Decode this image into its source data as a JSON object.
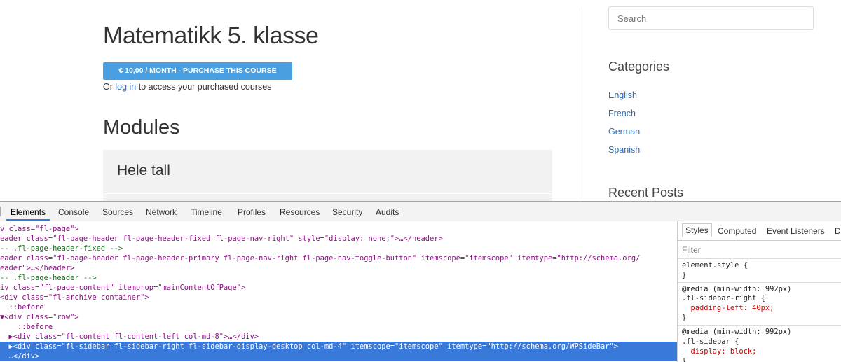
{
  "page": {
    "title": "Matematikk 5. klasse",
    "purchase_button": "€ 10,00 / MONTH - PURCHASE THIS COURSE",
    "login_prefix": "Or ",
    "login_link": "log in",
    "login_suffix": " to access your purchased courses",
    "modules_heading": "Modules",
    "module_name": "Hele tall"
  },
  "sidebar": {
    "search_placeholder": "Search",
    "categories_title": "Categories",
    "categories": [
      "English",
      "French",
      "German",
      "Spanish"
    ],
    "recent_posts_title": "Recent Posts"
  },
  "devtools": {
    "tabs": [
      "Elements",
      "Console",
      "Sources",
      "Network",
      "Timeline",
      "Profiles",
      "Resources",
      "Security",
      "Audits"
    ],
    "dom_lines": [
      {
        "t": "v class=\"fl-page\">"
      },
      {
        "t": "eader class=\"fl-page-header fl-page-header-fixed fl-page-nav-right\" style=\"display: none;\">…</header>"
      },
      {
        "t": "-- .fl-page-header-fixed -->"
      },
      {
        "t": "eader class=\"fl-page-header fl-page-header-primary fl-page-nav-right fl-page-nav-toggle-button\" itemscope=\"itemscope\" itemtype=\"http://schema.org/"
      },
      {
        "t": "eader\">…</header>"
      },
      {
        "t": "-- .fl-page-header -->"
      },
      {
        "t": "iv class=\"fl-page-content\" itemprop=\"mainContentOfPage\">"
      },
      {
        "t": "<div class=\"fl-archive container\">"
      },
      {
        "t": "  ::before"
      },
      {
        "t": "▼<div class=\"row\">"
      },
      {
        "t": "    ::before"
      },
      {
        "t": "  ▶<div class=\"fl-content fl-content-left col-md-8\">…</div>"
      },
      {
        "t": "  ▶<div class=\"fl-sidebar fl-sidebar-right fl-sidebar-display-desktop col-md-4\" itemscope=\"itemscope\" itemtype=\"http://schema.org/WPSideBar\">"
      },
      {
        "t": "  …</div>"
      }
    ],
    "styles_tabs": [
      "Styles",
      "Computed",
      "Event Listeners",
      "D"
    ],
    "filter_placeholder": "Filter",
    "style_lines": [
      "element.style {",
      "}",
      "@media (min-width: 992px)",
      ".fl-sidebar-right {",
      "  padding-left: 40px;",
      "}",
      "@media (min-width: 992px)",
      ".fl-sidebar {",
      "  display: block;",
      "}"
    ]
  }
}
